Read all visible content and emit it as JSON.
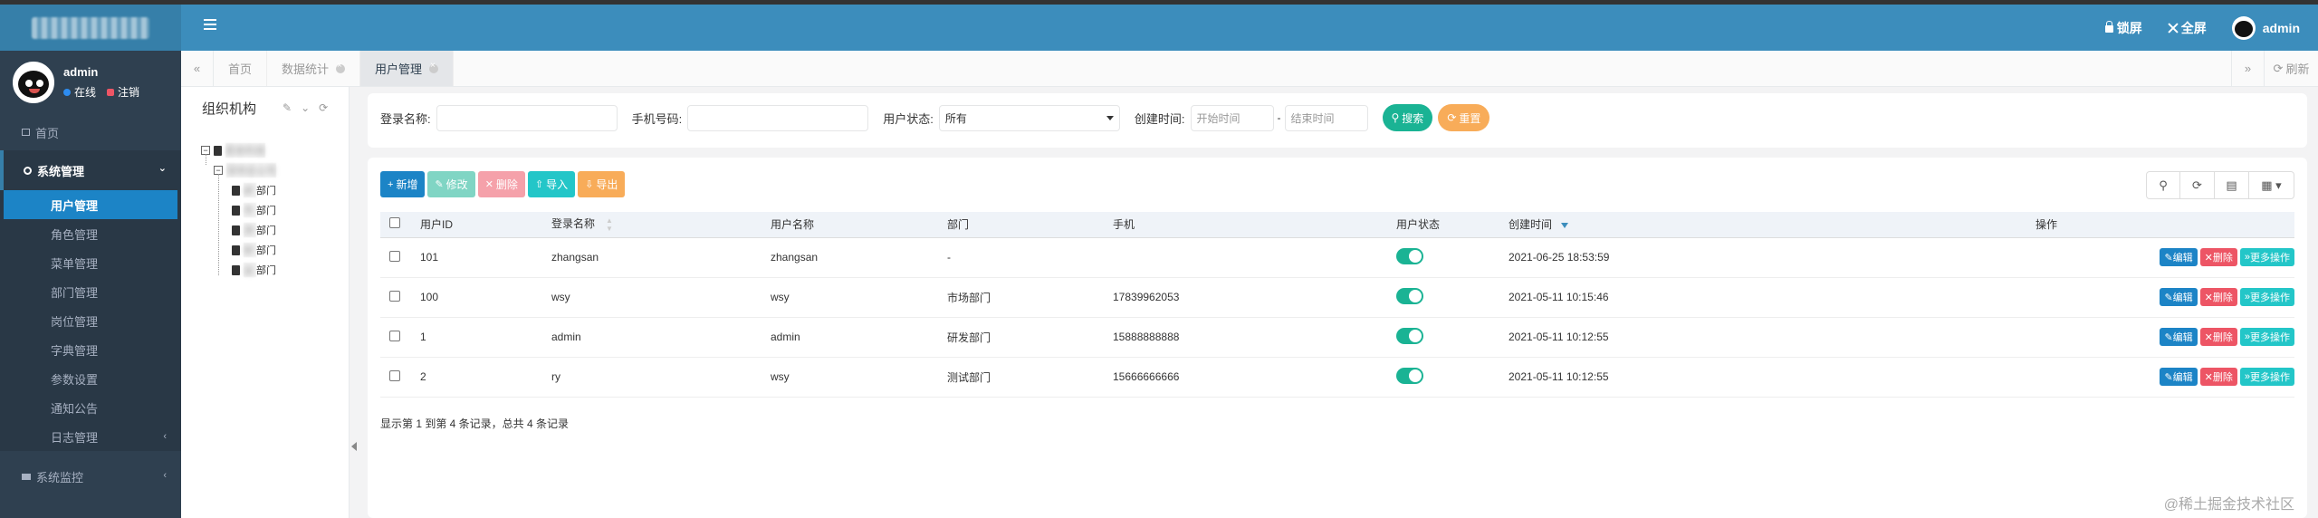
{
  "header": {
    "lock_label": "锁屏",
    "fullscreen_label": "全屏",
    "user_label": "admin"
  },
  "user": {
    "name": "admin",
    "status_online": "在线",
    "status_logout": "注销"
  },
  "sidebar": {
    "home": "首页",
    "system": "系统管理",
    "sub_items": [
      {
        "label": "用户管理"
      },
      {
        "label": "角色管理"
      },
      {
        "label": "菜单管理"
      },
      {
        "label": "部门管理"
      },
      {
        "label": "岗位管理"
      },
      {
        "label": "字典管理"
      },
      {
        "label": "参数设置"
      },
      {
        "label": "通知公告"
      },
      {
        "label": "日志管理"
      }
    ],
    "monitor": "系统监控"
  },
  "tabs": {
    "items": [
      "首页",
      "数据统计",
      "用户管理"
    ],
    "refresh": "刷新"
  },
  "org": {
    "title": "组织机构",
    "nodes": [
      "部门",
      "部门",
      "部门",
      "部门",
      "部门"
    ]
  },
  "search": {
    "login_name_label": "登录名称:",
    "phone_label": "手机号码:",
    "status_label": "用户状态:",
    "status_value": "所有",
    "created_label": "创建时间:",
    "start_placeholder": "开始时间",
    "dash": "-",
    "end_placeholder": "结束时间",
    "search_btn": "搜索",
    "reset_btn": "重置"
  },
  "toolbar": {
    "add": "新增",
    "edit": "修改",
    "delete": "删除",
    "import": "导入",
    "export": "导出"
  },
  "table": {
    "headers": {
      "id": "用户ID",
      "login": "登录名称",
      "name": "用户名称",
      "dept": "部门",
      "phone": "手机",
      "status": "用户状态",
      "created": "创建时间",
      "ops": "操作"
    },
    "rows": [
      {
        "id": "101",
        "login": "zhangsan",
        "name": "zhangsan",
        "dept": "-",
        "phone": "",
        "created": "2021-06-25 18:53:59"
      },
      {
        "id": "100",
        "login": "wsy",
        "name": "wsy",
        "dept": "市场部门",
        "phone": "17839962053",
        "created": "2021-05-11 10:15:46"
      },
      {
        "id": "1",
        "login": "admin",
        "name": "admin",
        "dept": "研发部门",
        "phone": "15888888888",
        "created": "2021-05-11 10:12:55"
      },
      {
        "id": "2",
        "login": "ry",
        "name": "wsy",
        "dept": "测试部门",
        "phone": "15666666666",
        "created": "2021-05-11 10:12:55"
      }
    ],
    "op_edit": "编辑",
    "op_delete": "删除",
    "op_more": "更多操作",
    "page_info": "显示第 1 到第 4 条记录，总共 4 条记录"
  },
  "watermark": "@稀土掘金技术社区",
  "colors": {
    "header": "#3c8dbc",
    "sidebar": "#2f4050",
    "active_item": "#1c84c6",
    "success": "#1ab394",
    "danger": "#ed5565",
    "warning": "#f8ac59",
    "info": "#23c6c8"
  }
}
